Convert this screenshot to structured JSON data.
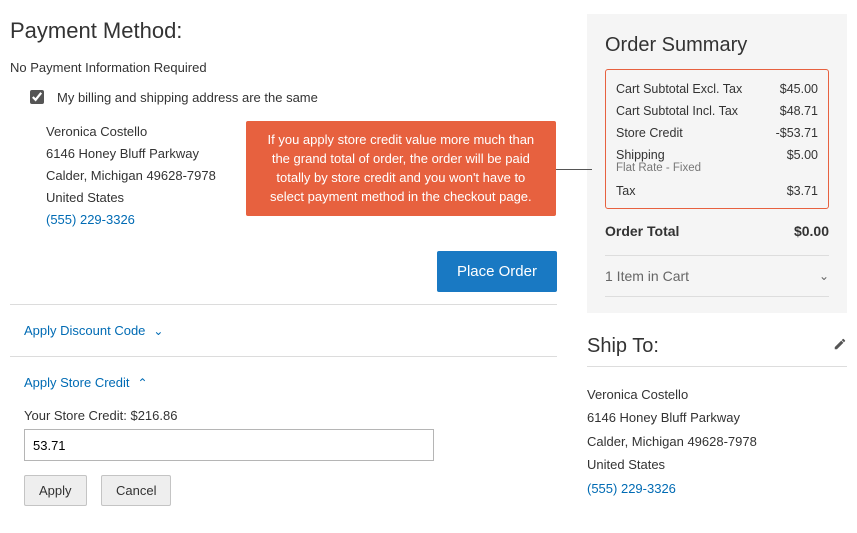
{
  "page": {
    "title": "Payment Method:",
    "no_payment": "No Payment Information Required",
    "billing_same_label": "My billing and shipping address are the same"
  },
  "billing_address": {
    "name": "Veronica Costello",
    "street": "6146 Honey Bluff Parkway",
    "city_line": "Calder, Michigan 49628-7978",
    "country": "United States",
    "phone": "(555) 229-3326"
  },
  "callout": {
    "text": "If you apply store credit value more much than the grand total of order, the order will be paid totally by store credit and you won't have to select payment method in the checkout page."
  },
  "actions": {
    "place_order": "Place Order",
    "apply_discount": "Apply Discount Code",
    "apply_store_credit": "Apply Store Credit",
    "apply": "Apply",
    "cancel": "Cancel"
  },
  "store_credit": {
    "balance_label": "Your Store Credit: $216.86",
    "input_value": "53.71"
  },
  "summary": {
    "title": "Order Summary",
    "rows": {
      "subtotal_excl": {
        "label": "Cart Subtotal Excl. Tax",
        "value": "$45.00"
      },
      "subtotal_incl": {
        "label": "Cart Subtotal Incl. Tax",
        "value": "$48.71"
      },
      "store_credit": {
        "label": "Store Credit",
        "value": "-$53.71"
      },
      "shipping": {
        "label": "Shipping",
        "value": "$5.00",
        "sub": "Flat Rate - Fixed"
      },
      "tax": {
        "label": "Tax",
        "value": "$3.71"
      }
    },
    "total": {
      "label": "Order Total",
      "value": "$0.00"
    },
    "items_in_cart": "1 Item in Cart"
  },
  "ship_to": {
    "title": "Ship To:",
    "address": {
      "name": "Veronica Costello",
      "street": "6146 Honey Bluff Parkway",
      "city_line": "Calder, Michigan 49628-7978",
      "country": "United States",
      "phone": "(555) 229-3326"
    }
  }
}
